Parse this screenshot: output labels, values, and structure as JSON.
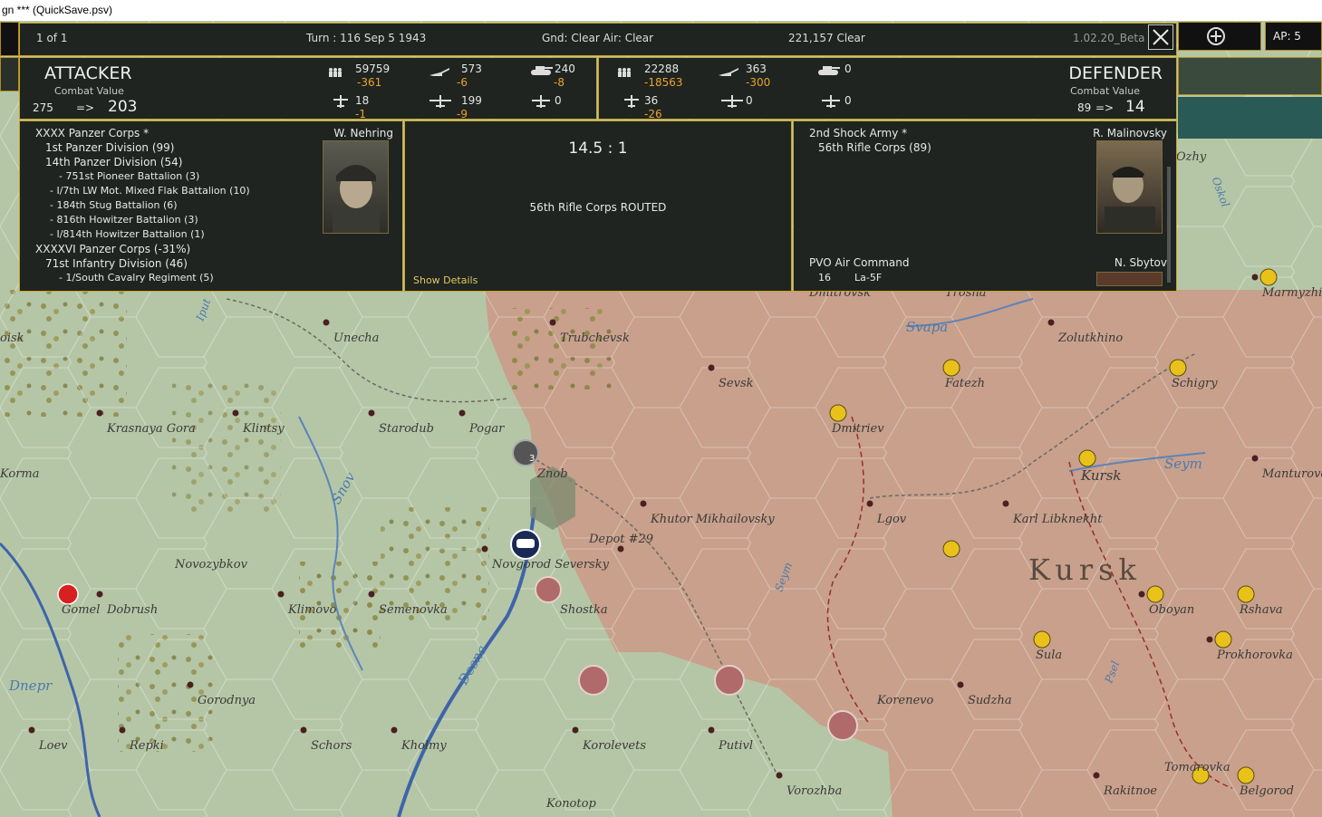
{
  "window": {
    "title": "gn   ***   (QuickSave.psv)"
  },
  "topbar": {
    "ap": "AP: 5"
  },
  "infobar": {
    "page": "1 of 1",
    "turn": "Turn : 116   Sep 5 1943",
    "weather": "Gnd: Clear  Air: Clear",
    "location": "221,157   Clear",
    "version": "1.02.20_Beta"
  },
  "attacker": {
    "title": "ATTACKER",
    "cv_label": "Combat Value",
    "cv_from": "275",
    "arrow": "=>",
    "cv_to": "203",
    "stats": {
      "men": "59759",
      "men_loss": "-361",
      "guns": "573",
      "guns_loss": "-6",
      "afv": "240",
      "afv_loss": "-8",
      "fighters": "18",
      "fighters_loss": "-1",
      "bombers": "199",
      "bombers_loss": "-9",
      "recon": "0"
    },
    "commander": "W. Nehring",
    "units": [
      "XXXX Panzer Corps *",
      "1st Panzer Division (99)",
      "14th Panzer Division (54)",
      "- 751st Pioneer Battalion (3)",
      "- I/7th LW Mot. Mixed Flak Battalion (10)",
      "- 184th Stug Battalion (6)",
      "- 816th Howitzer Battalion (3)",
      "- I/814th Howitzer Battalion (1)",
      "XXXXVI Panzer Corps (-31%)",
      "71st Infantry Division (46)",
      "- 1/South Cavalry Regiment (5)"
    ]
  },
  "defender": {
    "title": "DEFENDER",
    "cv_label": "Combat Value",
    "cv_from": "89",
    "arrow": "=>",
    "cv_to": "14",
    "stats": {
      "men": "22288",
      "men_loss": "-18563",
      "guns": "363",
      "guns_loss": "-300",
      "afv": "0",
      "fighters": "36",
      "fighters_loss": "-26",
      "bombers": "0",
      "recon": "0"
    },
    "commander": "R. Malinovsky",
    "units": [
      "2nd Shock Army *",
      "56th Rifle Corps (89)"
    ],
    "air_command": "PVO Air Command",
    "air_commander": "N. Sbytov",
    "air_count": "16",
    "air_type": "La-5F"
  },
  "result": {
    "odds": "14.5 : 1",
    "message": "56th Rifle Corps ROUTED",
    "details_link": "Show Details"
  },
  "map": {
    "towns": [
      "Dmitrovsk",
      "Trosna",
      "Unecha",
      "Trubchevsk",
      "Sevsk",
      "Zolutkhino",
      "Fatezh",
      "Schigry",
      "Marmyzhi",
      "Krasnaya Gora",
      "Klintsy",
      "Starodub",
      "Pogar",
      "Dmitriev",
      "Korma",
      "Znob",
      "Kursk",
      "Manturovo",
      "Khutor Mikhailovsky",
      "Lgov",
      "Karl Libknekht",
      "Depot #29",
      "Novozybkov",
      "Novgorod Seversky",
      "Gomel",
      "Dobrush",
      "Klimovo",
      "Semenovka",
      "Shostka",
      "Oboyan",
      "Rshava",
      "Sula",
      "Prokhorovka",
      "Gorodnya",
      "Korenevo",
      "Sudzha",
      "Loev",
      "Repki",
      "Schors",
      "Kholmy",
      "Korolevets",
      "Putivl",
      "Tomarovka",
      "Vorozhba",
      "Rakitnoe",
      "Belgorod",
      "Konotop",
      "oisk",
      "Ozhy"
    ],
    "rivers": [
      "Svapa",
      "Seym",
      "Snov",
      "Desna",
      "Dnepr",
      "Seym",
      "Psel",
      "Oskol",
      "Iput"
    ],
    "region": "Kursk",
    "stack_count": "3"
  },
  "colors": {
    "panel_border": "#c9a227",
    "loss": "#e9a32b",
    "soviet_territory": "#c89a88",
    "axis_territory": "#b8c7a8"
  }
}
